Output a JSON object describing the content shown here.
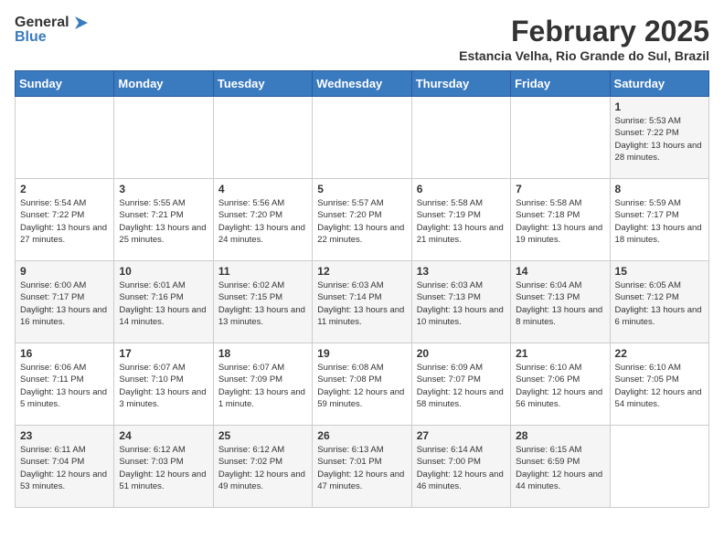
{
  "header": {
    "logo_general": "General",
    "logo_blue": "Blue",
    "month_year": "February 2025",
    "location": "Estancia Velha, Rio Grande do Sul, Brazil"
  },
  "weekdays": [
    "Sunday",
    "Monday",
    "Tuesday",
    "Wednesday",
    "Thursday",
    "Friday",
    "Saturday"
  ],
  "weeks": [
    [
      {
        "day": "",
        "info": ""
      },
      {
        "day": "",
        "info": ""
      },
      {
        "day": "",
        "info": ""
      },
      {
        "day": "",
        "info": ""
      },
      {
        "day": "",
        "info": ""
      },
      {
        "day": "",
        "info": ""
      },
      {
        "day": "1",
        "info": "Sunrise: 5:53 AM\nSunset: 7:22 PM\nDaylight: 13 hours and 28 minutes."
      }
    ],
    [
      {
        "day": "2",
        "info": "Sunrise: 5:54 AM\nSunset: 7:22 PM\nDaylight: 13 hours and 27 minutes."
      },
      {
        "day": "3",
        "info": "Sunrise: 5:55 AM\nSunset: 7:21 PM\nDaylight: 13 hours and 25 minutes."
      },
      {
        "day": "4",
        "info": "Sunrise: 5:56 AM\nSunset: 7:20 PM\nDaylight: 13 hours and 24 minutes."
      },
      {
        "day": "5",
        "info": "Sunrise: 5:57 AM\nSunset: 7:20 PM\nDaylight: 13 hours and 22 minutes."
      },
      {
        "day": "6",
        "info": "Sunrise: 5:58 AM\nSunset: 7:19 PM\nDaylight: 13 hours and 21 minutes."
      },
      {
        "day": "7",
        "info": "Sunrise: 5:58 AM\nSunset: 7:18 PM\nDaylight: 13 hours and 19 minutes."
      },
      {
        "day": "8",
        "info": "Sunrise: 5:59 AM\nSunset: 7:17 PM\nDaylight: 13 hours and 18 minutes."
      }
    ],
    [
      {
        "day": "9",
        "info": "Sunrise: 6:00 AM\nSunset: 7:17 PM\nDaylight: 13 hours and 16 minutes."
      },
      {
        "day": "10",
        "info": "Sunrise: 6:01 AM\nSunset: 7:16 PM\nDaylight: 13 hours and 14 minutes."
      },
      {
        "day": "11",
        "info": "Sunrise: 6:02 AM\nSunset: 7:15 PM\nDaylight: 13 hours and 13 minutes."
      },
      {
        "day": "12",
        "info": "Sunrise: 6:03 AM\nSunset: 7:14 PM\nDaylight: 13 hours and 11 minutes."
      },
      {
        "day": "13",
        "info": "Sunrise: 6:03 AM\nSunset: 7:13 PM\nDaylight: 13 hours and 10 minutes."
      },
      {
        "day": "14",
        "info": "Sunrise: 6:04 AM\nSunset: 7:13 PM\nDaylight: 13 hours and 8 minutes."
      },
      {
        "day": "15",
        "info": "Sunrise: 6:05 AM\nSunset: 7:12 PM\nDaylight: 13 hours and 6 minutes."
      }
    ],
    [
      {
        "day": "16",
        "info": "Sunrise: 6:06 AM\nSunset: 7:11 PM\nDaylight: 13 hours and 5 minutes."
      },
      {
        "day": "17",
        "info": "Sunrise: 6:07 AM\nSunset: 7:10 PM\nDaylight: 13 hours and 3 minutes."
      },
      {
        "day": "18",
        "info": "Sunrise: 6:07 AM\nSunset: 7:09 PM\nDaylight: 13 hours and 1 minute."
      },
      {
        "day": "19",
        "info": "Sunrise: 6:08 AM\nSunset: 7:08 PM\nDaylight: 12 hours and 59 minutes."
      },
      {
        "day": "20",
        "info": "Sunrise: 6:09 AM\nSunset: 7:07 PM\nDaylight: 12 hours and 58 minutes."
      },
      {
        "day": "21",
        "info": "Sunrise: 6:10 AM\nSunset: 7:06 PM\nDaylight: 12 hours and 56 minutes."
      },
      {
        "day": "22",
        "info": "Sunrise: 6:10 AM\nSunset: 7:05 PM\nDaylight: 12 hours and 54 minutes."
      }
    ],
    [
      {
        "day": "23",
        "info": "Sunrise: 6:11 AM\nSunset: 7:04 PM\nDaylight: 12 hours and 53 minutes."
      },
      {
        "day": "24",
        "info": "Sunrise: 6:12 AM\nSunset: 7:03 PM\nDaylight: 12 hours and 51 minutes."
      },
      {
        "day": "25",
        "info": "Sunrise: 6:12 AM\nSunset: 7:02 PM\nDaylight: 12 hours and 49 minutes."
      },
      {
        "day": "26",
        "info": "Sunrise: 6:13 AM\nSunset: 7:01 PM\nDaylight: 12 hours and 47 minutes."
      },
      {
        "day": "27",
        "info": "Sunrise: 6:14 AM\nSunset: 7:00 PM\nDaylight: 12 hours and 46 minutes."
      },
      {
        "day": "28",
        "info": "Sunrise: 6:15 AM\nSunset: 6:59 PM\nDaylight: 12 hours and 44 minutes."
      },
      {
        "day": "",
        "info": ""
      }
    ]
  ]
}
